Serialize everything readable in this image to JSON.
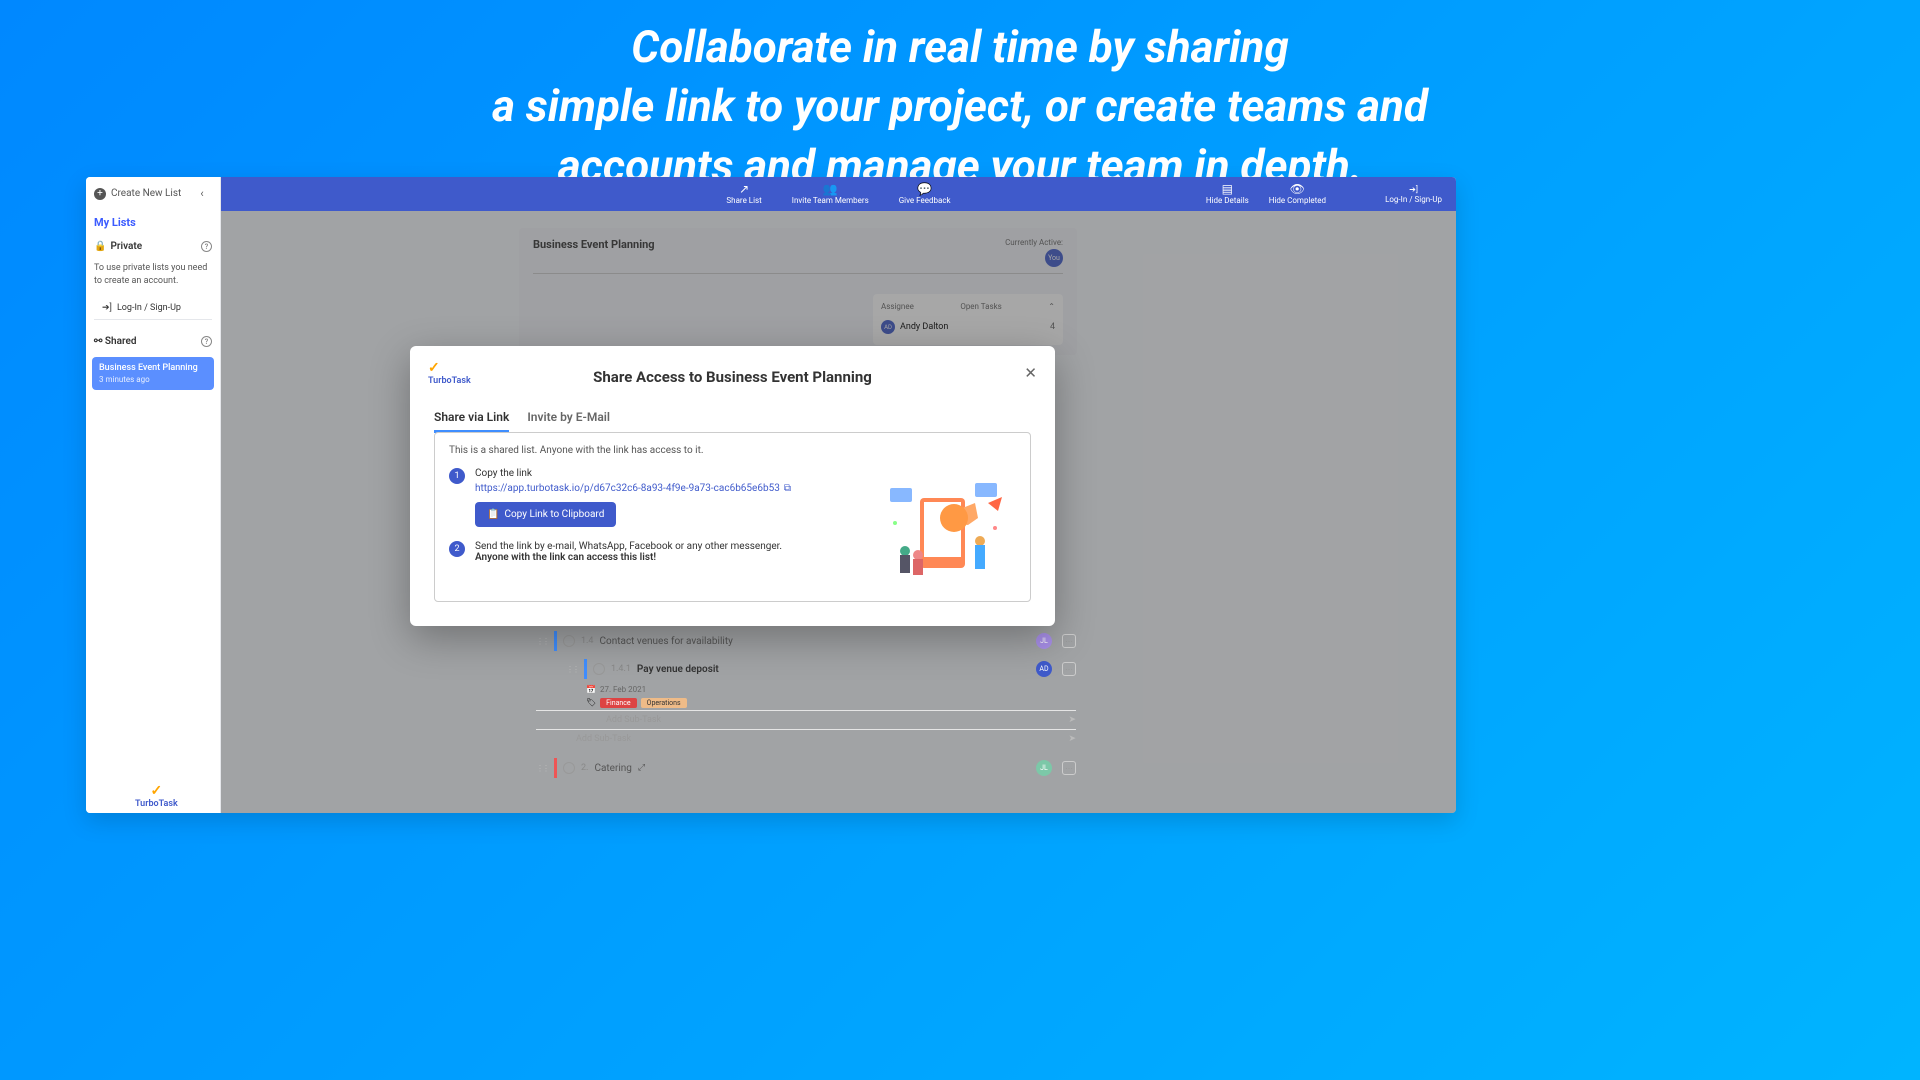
{
  "hero": {
    "line1": "Collaborate in real time by sharing",
    "line2": "a simple link to your project, or create teams and",
    "line3": "accounts and manage your team in depth."
  },
  "sidebar": {
    "create_label": "Create New List",
    "my_lists": "My Lists",
    "private": "Private",
    "private_msg": "To use private lists you need to create an account.",
    "login_label": "Log-In / Sign-Up",
    "shared": "Shared",
    "shared_item": {
      "title": "Business Event Planning",
      "time": "3 minutes ago"
    }
  },
  "topbar": {
    "share": "Share List",
    "invite": "Invite Team Members",
    "feedback": "Give Feedback",
    "hide_details": "Hide Details",
    "hide_completed": "Hide Completed",
    "login": "Log-In / Sign-Up"
  },
  "main": {
    "title": "Business Event Planning",
    "currently": "Currently Active:",
    "you": "You",
    "assignee_header": "Assignee",
    "open_header": "Open Tasks",
    "andy": "Andy Dalton",
    "andy_count": "4"
  },
  "tasks": {
    "t14_num": "1.4",
    "t14_title": "Contact venues for availability",
    "t141_num": "1.4.1",
    "t141_title": "Pay venue deposit",
    "t141_date": "27. Feb 2021",
    "tag_finance": "Finance",
    "tag_ops": "Operations",
    "add_sub": "Add Sub-Task",
    "t2_num": "2.",
    "t2_title": "Catering"
  },
  "modal": {
    "brand": "TurboTask",
    "title": "Share Access to Business Event Planning",
    "tab_link": "Share via Link",
    "tab_email": "Invite by E-Mail",
    "desc": "This is a shared list. Anyone with the link has access to it.",
    "step1_title": "Copy the link",
    "step1_url": "https://app.turbotask.io/p/d67c32c6-8a93-4f9e-9a73-cac6b65e6b53",
    "copy_btn": "Copy Link to Clipboard",
    "step2_title": "Send the link by e-mail, WhatsApp, Facebook or any other messenger.",
    "step2_warn": "Anyone with the link can access this list!"
  },
  "assignees": {
    "jl": "JL",
    "ad": "AD"
  }
}
